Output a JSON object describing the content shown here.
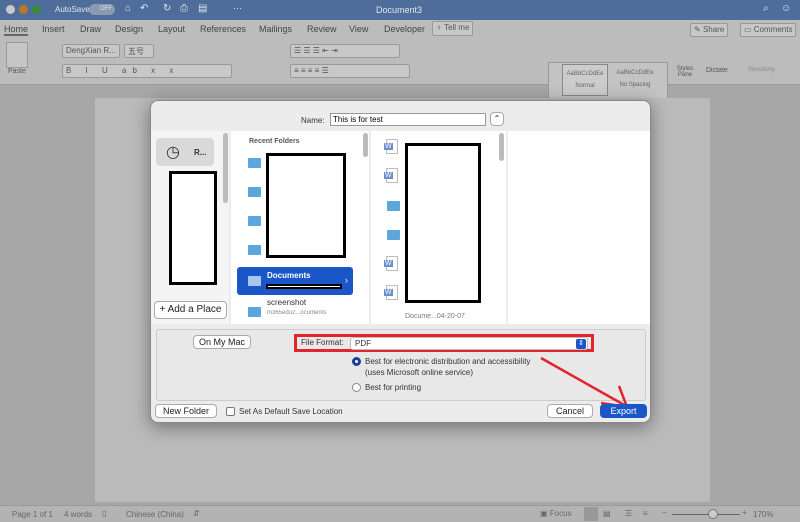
{
  "titlebar": {
    "autosave": "AutoSave",
    "autosave_state": "OFF",
    "title": "Document3"
  },
  "ribbon": {
    "tabs": [
      "Home",
      "Insert",
      "Draw",
      "Design",
      "Layout",
      "References",
      "Mailings",
      "Review",
      "View",
      "Developer"
    ],
    "tell_me": "Tell me",
    "share": "Share",
    "comments": "Comments",
    "paste": "Paste",
    "font": "DengXian R...",
    "size": "五号",
    "styles": [
      {
        "preview": "AaBbCcDdEe",
        "label": "Normal"
      },
      {
        "preview": "AaBbCcDdEe",
        "label": "No Spacing"
      }
    ],
    "styles_pane": "Styles Pane",
    "dictate": "Dictate",
    "sensitivity": "Sensitivity"
  },
  "dialog": {
    "name_label": "Name:",
    "name_value": "This is for test",
    "sidebar_recents": "R...",
    "add_place": "Add a Place",
    "recent_folders": "Recent Folders",
    "documents": "Documents",
    "screenshot": "screenshot",
    "screenshot_sub": "m365edu2...ocuments",
    "file_partial": "Docume...04-20-07",
    "on_my_mac": "On My Mac",
    "file_format_label": "File Format:",
    "file_format_value": "PDF",
    "option1": "Best for electronic distribution and accessibility",
    "option1_sub": "(uses Microsoft online service)",
    "option2": "Best for printing",
    "option_selected": 1,
    "new_folder": "New Folder",
    "default_location": "Set As Default Save Location",
    "cancel": "Cancel",
    "export": "Export",
    "highlight_color": "#e0262c",
    "accent": "#1a56c8"
  },
  "status": {
    "page": "Page 1 of 1",
    "words": "4 words",
    "language": "Chinese (China)",
    "focus": "Focus",
    "zoom": "170%",
    "zoom_level": 0.6
  }
}
